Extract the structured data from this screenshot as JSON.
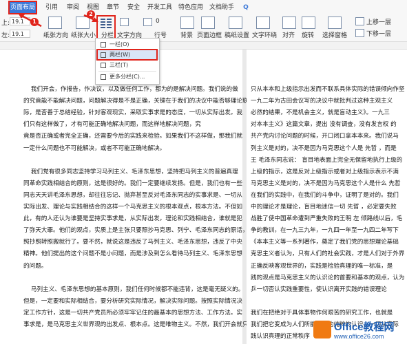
{
  "tabs": [
    "页面布局",
    "引用",
    "审阅",
    "视图",
    "章节",
    "安全",
    "开发工具",
    "特色应用",
    "文档助手",
    "Q"
  ],
  "ribbon": {
    "margin_value": "19.1",
    "paper_dir_label": "纸张方向",
    "paper_size_label": "纸张大小",
    "columns_label": "分栏",
    "text_dir_label": "文字方向",
    "line_num_label": "行号",
    "background_label": "背景",
    "page_border_label": "页面边框",
    "draft_grid_label": "稿纸设置",
    "text_wrap_label": "文字环绕",
    "align_label": "对齐",
    "rotate_label": "旋转",
    "select_pane_label": "选择窗格",
    "up_label": "上移一层",
    "down_label": "下移一层",
    "indent_label": "0",
    "spacing_label": "0",
    "badges": [
      "1",
      "2",
      "3"
    ]
  },
  "columns_menu": {
    "items": [
      "一栏(O)",
      "两栏(W)",
      "三栏(T)",
      "更多分栏(C)..."
    ]
  },
  "doc_left": [
    "    我们开会，作报告，作决议，以及做任何工作，都为的是解决问题。我们说的做",
    "的究竟能不能解决问题，问题解决得是不是正确，关键在于我们的决议中能否够理论联系实",
    "际，是否善于总结经验，针对客观现实，采取实事求是的态度，一切从实际出发。我",
    "们只有这样做了，才有可能正确地解决问题，而这样地解决问题，究",
    "竟是否正确或者完全正确，还需要今后的实践来检验。如果我们不这样做，那我们就",
    "一定什么问题也不可能解决，或者不可能正确地解决。",
    "",
    "    我们党有很多同志坚持学习马列主义、毛泽东思想，坚持把马列主义的普遍真理",
    "同革命实践相结合的原则，这是很好的。我们一定要继续发扬。但是，我们也有一些",
    "同志天天讲毛泽东思想，却往往忘记、抛弃甚至反对毛泽东同志的实事求是、一切从",
    "实际出发、理论与实践相结合的这样一个马克思主义的根本观点，根本方法。不但如",
    "此，有的人还认为谁要是坚持实事求是，从实际出发，理论和实践相结合，谁就是犯",
    "了弥天大罪。他们的观点，实质上是主张只要照抄马克思、列宁、毛泽东同志的原话，",
    "照抄照转照搬就行了。要不然，就说这是违反了马列主义、毛泽东思想，违反了中央",
    "精神。他们提出的这个问题不是小问题，而是涉及到怎么看待马列主义、毛泽东思想",
    "的问题。",
    "",
    "    马列主义、毛泽东思想的基本原则，我们任何时候都不能违背，这是毫无疑义的。",
    "但是，一定要和实际相结合，要分析研究实际情况，解决实际问题。按照实际情况决",
    "定工作方针，这是一切共产党员所必须牢牢记住的最基本的思想方法、工作方法。实",
    "事求是，是马克思主义世界观的出发点、根本点。这是唯物主义。不然，我们开会就只能"
  ],
  "doc_right": [
    "只从本本和上级指示出发而不联系具体实际的错误倾向作坚",
    "一九二年为古田会议写的决议中就批判过这种主观主义",
    "必然的结果，不是机会主义，就是盲动主义》。一九三",
    "对本本主义》这篇文章，提出 没有调查，没有发言权 的",
    "共产党内讨论问题的时候，开口闭口拿本本来。我们说马",
    "列主义是对的，决不是因为马克思这个人是 先哲 ，而是",
    "王 毛泽东同志说： 盲目地表面上完全无保留地执行上级的",
    "上级的指示，这是反对上级指示或者对上级指示表示不满",
    "马克思主义是对的，决不是因为马克思这个人是什么 先哲",
    "在我们的实践中，在我们的斗争中，证明了是对的。我们",
    "中的理论才是理论，盲目地迷信一切 先哲 ，必定要失败",
    "战胜了使中国革命遭到严重失败的王明 左 倾路线以后，毛",
    "争的教训，在一九三九年，一九四一年至一九四二年写下",
    "《本本主义等一系列著作，奠定了我们党的思想理论基础",
    "克思主义者认为，只有人们的社会实践，才是人们对于外界",
    "正确反映客观世界的，实践是检验真理的唯一标准，是",
    "践的观点是马克思主义的认识论的首要和基本的观点，认为",
    "乒一切否认实践重要性，使认识离开实践的错误理论",
    "",
    "我们在把绝对于具体事物作何艰苦的研究工作，也就是",
    "我们把它变成为人们所能掌握的纯粹的认识，一切从实际",
    "践认识真理的正常秩序"
  ],
  "watermark": {
    "brand": "Office教程网",
    "url": "www.office26.com"
  }
}
